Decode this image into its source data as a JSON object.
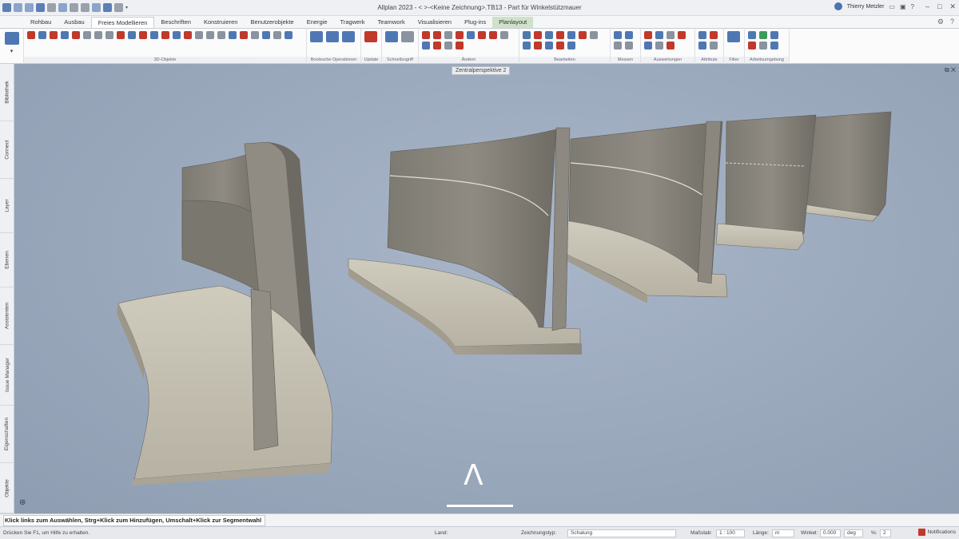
{
  "window": {
    "title": "Allplan 2023 - <   >-<Keine Zeichnung>.TB13 - Part für Winkelstützmauer",
    "user": "Thierry Metzler"
  },
  "ribbon_tabs": [
    {
      "label": "Rohbau"
    },
    {
      "label": "Ausbau"
    },
    {
      "label": "Freies Modellieren"
    },
    {
      "label": "Beschriften"
    },
    {
      "label": "Konstruieren"
    },
    {
      "label": "Benutzerobjekte"
    },
    {
      "label": "Energie"
    },
    {
      "label": "Tragwerk"
    },
    {
      "label": "Teamwork"
    },
    {
      "label": "Visualisieren"
    },
    {
      "label": "Plug-ins"
    },
    {
      "label": "Planlayout"
    }
  ],
  "ribbon_groups": [
    {
      "label": "3D-Objekte"
    },
    {
      "label": "Boolesche Operationen"
    },
    {
      "label": "Update"
    },
    {
      "label": "Schnellzugriff"
    },
    {
      "label": "Ändern"
    },
    {
      "label": "Bearbeiten"
    },
    {
      "label": "Messen"
    },
    {
      "label": "Auswertungen"
    },
    {
      "label": "Attribute"
    },
    {
      "label": "Filter"
    },
    {
      "label": "Arbeitsumgebung"
    }
  ],
  "side_tabs": [
    {
      "label": "Bibliothek"
    },
    {
      "label": "Connect"
    },
    {
      "label": "Layer"
    },
    {
      "label": "Ebenen"
    },
    {
      "label": "Assistenten"
    },
    {
      "label": "Issue Manager"
    },
    {
      "label": "Eigenschaften"
    },
    {
      "label": "Objekte"
    }
  ],
  "viewport": {
    "title": "Zentralperspektive 2",
    "overlay_symbol": "Λ"
  },
  "hint": "Klick links zum Auswählen, Strg+Klick zum Hinzufügen, Umschalt+Klick zur Segmentwahl",
  "status": {
    "help": "Drücken Sie F1, um Hilfe zu erhalten.",
    "land_label": "Land:",
    "drawing_type_label": "Zeichnungstyp:",
    "drawing_type": "Schalung",
    "scale_label": "Maßstab:",
    "scale": "1 : 100",
    "length_label": "Länge:",
    "length_unit": "m",
    "angle_label": "Winkel:",
    "angle": "0.000",
    "angle_unit": "deg",
    "percent_label": "%:",
    "percent": "2",
    "notifications": "Notifications"
  },
  "colors": {
    "viewport_bg": "#9aa8bc",
    "concrete": "#b3ad9f",
    "ribbon_accent": "#4f78b3"
  }
}
